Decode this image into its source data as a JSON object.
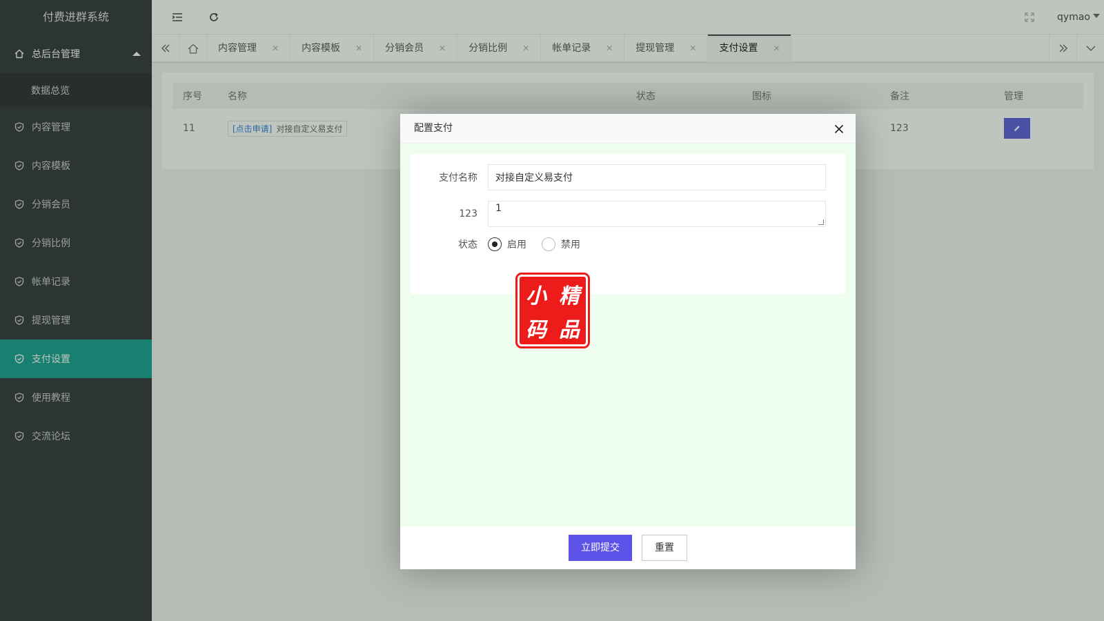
{
  "app": {
    "title": "付费进群系统",
    "user": "qymao"
  },
  "sidebar": {
    "parent": {
      "label": "总后台管理"
    },
    "sub": {
      "label": "数据总览"
    },
    "items": [
      {
        "label": "内容管理"
      },
      {
        "label": "内容模板"
      },
      {
        "label": "分销会员"
      },
      {
        "label": "分销比例"
      },
      {
        "label": "帐单记录"
      },
      {
        "label": "提现管理"
      },
      {
        "label": "支付设置",
        "active": true
      },
      {
        "label": "使用教程"
      },
      {
        "label": "交流论坛"
      }
    ]
  },
  "tabs": [
    {
      "label": "内容管理"
    },
    {
      "label": "内容模板"
    },
    {
      "label": "分销会员"
    },
    {
      "label": "分销比例"
    },
    {
      "label": "帐单记录"
    },
    {
      "label": "提现管理"
    },
    {
      "label": "支付设置",
      "active": true
    }
  ],
  "table": {
    "headers": [
      "序号",
      "名称",
      "状态",
      "图标",
      "备注",
      "管理"
    ],
    "rows": [
      {
        "id": "11",
        "link": "[点击申请]",
        "name": "对接自定义易支付",
        "remark": "123"
      }
    ]
  },
  "modal": {
    "title": "配置支付",
    "fields": {
      "name_label": "支付名称",
      "name_value": "对接自定义易支付",
      "extra_label": "123",
      "extra_value": "1",
      "status_label": "状态",
      "status_on": "启用",
      "status_off": "禁用"
    },
    "seal_chars": [
      "小",
      "精",
      "码",
      "品"
    ],
    "submit": "立即提交",
    "reset": "重置"
  },
  "colors": {
    "sidebar_bg": "#20222a",
    "active": "#009688",
    "primary": "#5c52e8"
  }
}
